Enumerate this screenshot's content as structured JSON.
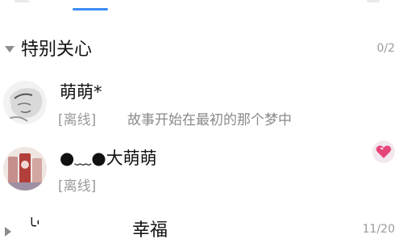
{
  "groups": [
    {
      "name": "特别关心",
      "count": "0/2"
    },
    {
      "name": "幸福",
      "count": "11/20"
    }
  ],
  "contacts": [
    {
      "name": "萌萌*",
      "status": "[离线]",
      "signature": "故事开始在最初的那个梦中"
    },
    {
      "name": "●﹏●大萌萌",
      "status": "[离线]"
    }
  ],
  "partial_text": "╰'",
  "colors": {
    "tab_indicator": "#3a8df5",
    "secondary_text": "#9a9a9a",
    "heart_badge": "#e6457a"
  }
}
